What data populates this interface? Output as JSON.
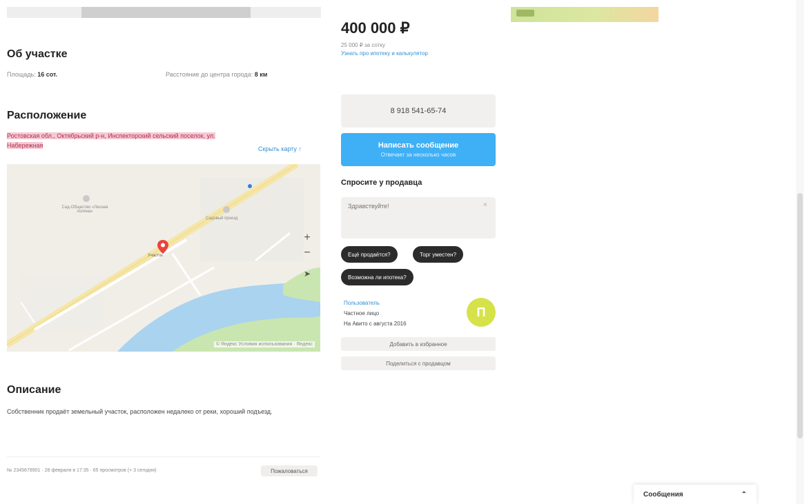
{
  "price": {
    "value": "400 000 ₽",
    "per_unit": "25 000 ₽ за сотку",
    "mortgage_link": "Узнать про ипотеку и калькулятор"
  },
  "about": {
    "title": "Об участке",
    "area_label": "Площадь:",
    "area_value": "16 сот.",
    "distance_label": "Расстояние до центра города:",
    "distance_value": "8 км"
  },
  "location": {
    "title": "Расположение",
    "address": "Ростовская обл., Октябрьский р-н, Инспекторский сельский поселок, ул. Набережная",
    "show_map_link": "Скрыть карту ↑",
    "map_labels": {
      "poi_1": "Сад-Общество «Лесная поляна»",
      "poi_2": "Садовый проезд",
      "marker_label": "Участок"
    },
    "map_attribution": "© Яндекс Условия использования · Яндекс"
  },
  "description": {
    "title": "Описание",
    "text": "Собственник продаёт земельный участок, расположен недалеко от реки, хороший подъезд."
  },
  "footer": {
    "meta": "№ 2345678901 · 28 февраля в 17:35 · 65 просмотров (+ 3 сегодня)",
    "report_label": "Пожаловаться"
  },
  "contact": {
    "phone": "8 918 541-65-74",
    "message_button": "Написать сообщение",
    "message_sub": "Отвечает за несколько часов",
    "ask_title": "Спросите у продавца",
    "ask_placeholder": "Здравствуйте!",
    "chips": [
      "Ещё продаётся?",
      "Торг уместен?",
      "Возможна ли ипотека?"
    ]
  },
  "seller": {
    "type_link": "Пользователь",
    "name": "Частное лицо",
    "since": "На Авито с августа 2016",
    "avatar_letter": "П"
  },
  "actions": {
    "subscribe": "Добавить в избранное",
    "share": "Поделиться с продавцом"
  },
  "messages_bar": {
    "label": "Сообщения",
    "chevron": "⌃"
  }
}
